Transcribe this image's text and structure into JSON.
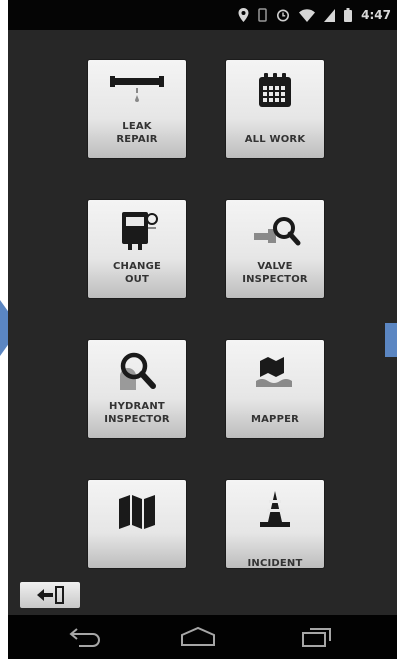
{
  "status_bar": {
    "time": "4:47",
    "icons": [
      "location-icon",
      "vibrate-icon",
      "alarm-icon",
      "wifi-icon",
      "signal-icon",
      "battery-icon"
    ]
  },
  "tiles": [
    {
      "id": "leak-repair",
      "lines": [
        "LEAK",
        "REPAIR"
      ],
      "icon": "pipe-icon"
    },
    {
      "id": "all-work",
      "lines": [
        "ALL WORK"
      ],
      "icon": "calendar-icon"
    },
    {
      "id": "change-out",
      "lines": [
        "CHANGE",
        "OUT"
      ],
      "icon": "meter-icon"
    },
    {
      "id": "valve-inspector",
      "lines": [
        "VALVE",
        "INSPECTOR"
      ],
      "icon": "valve-search-icon"
    },
    {
      "id": "hydrant-inspector",
      "lines": [
        "HYDRANT",
        "INSPECTOR"
      ],
      "icon": "magnifier-icon"
    },
    {
      "id": "mapper",
      "lines": [
        "MAPPER"
      ],
      "icon": "flooded-map-icon"
    },
    {
      "id": "map",
      "lines": [
        ""
      ],
      "icon": "folded-map-icon"
    },
    {
      "id": "incident",
      "lines": [
        "INCIDENT"
      ],
      "icon": "traffic-cone-icon"
    }
  ],
  "logout": {
    "icon": "logout-icon"
  },
  "nav": {
    "back": "back-icon",
    "home": "home-icon",
    "recents": "recent-apps-icon"
  },
  "colors": {
    "screen_bg": "#272727",
    "tile_bg": "#ececec",
    "arrow": "#5b86c2"
  }
}
